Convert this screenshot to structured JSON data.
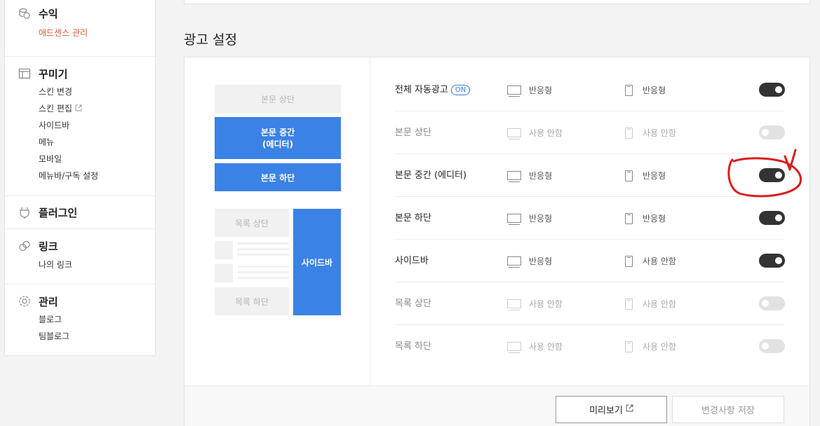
{
  "sidebar": {
    "groups": [
      {
        "title": "수익",
        "icon": "coins-icon",
        "items": [
          {
            "label": "애드센스 관리",
            "active": true
          }
        ]
      },
      {
        "title": "꾸미기",
        "icon": "layout-icon",
        "items": [
          {
            "label": "스킨 변경"
          },
          {
            "label": "스킨 편집",
            "external": true
          },
          {
            "label": "사이드바"
          },
          {
            "label": "메뉴"
          },
          {
            "label": "모바일"
          },
          {
            "label": "메뉴바/구독 설정"
          }
        ]
      },
      {
        "title": "플러그인",
        "icon": "plug-icon",
        "items": []
      },
      {
        "title": "링크",
        "icon": "link-icon",
        "items": [
          {
            "label": "나의 링크"
          }
        ]
      },
      {
        "title": "관리",
        "icon": "gear-icon",
        "items": [
          {
            "label": "블로그"
          },
          {
            "label": "팀블로그"
          }
        ]
      }
    ]
  },
  "main": {
    "section_title": "광고 설정",
    "diagram": {
      "top": "본문 상단",
      "middle_line1": "본문 중간",
      "middle_line2": "(에디터)",
      "bottom": "본문 하단",
      "list_top": "목록 상단",
      "list_bottom": "목록 하단",
      "sidebar": "사이드바"
    },
    "rows": [
      {
        "name": "전체 자동광고",
        "badge": "ON",
        "pc": "반응형",
        "mobile": "반응형",
        "enabled": true,
        "pc_on": true,
        "mobile_on": true
      },
      {
        "name": "본문 상단",
        "pc": "사용 안함",
        "mobile": "사용 안함",
        "enabled": false,
        "pc_on": false,
        "mobile_on": false
      },
      {
        "name": "본문 중간 (에디터)",
        "pc": "반응형",
        "mobile": "반응형",
        "enabled": true,
        "pc_on": true,
        "mobile_on": true
      },
      {
        "name": "본문 하단",
        "pc": "반응형",
        "mobile": "반응형",
        "enabled": true,
        "pc_on": true,
        "mobile_on": true
      },
      {
        "name": "사이드바",
        "pc": "반응형",
        "mobile": "사용 안함",
        "enabled": true,
        "pc_on": true,
        "mobile_on": true
      },
      {
        "name": "목록 상단",
        "pc": "사용 안함",
        "mobile": "사용 안함",
        "enabled": false,
        "pc_on": false,
        "mobile_on": false
      },
      {
        "name": "목록 하단",
        "pc": "사용 안함",
        "mobile": "사용 안함",
        "enabled": false,
        "pc_on": false,
        "mobile_on": false
      }
    ],
    "buttons": {
      "preview": "미리보기",
      "save": "변경사항 저장"
    }
  },
  "colors": {
    "accent": "#3b82e6",
    "active_link": "#e05a3e",
    "annotation": "#d81e1e"
  }
}
